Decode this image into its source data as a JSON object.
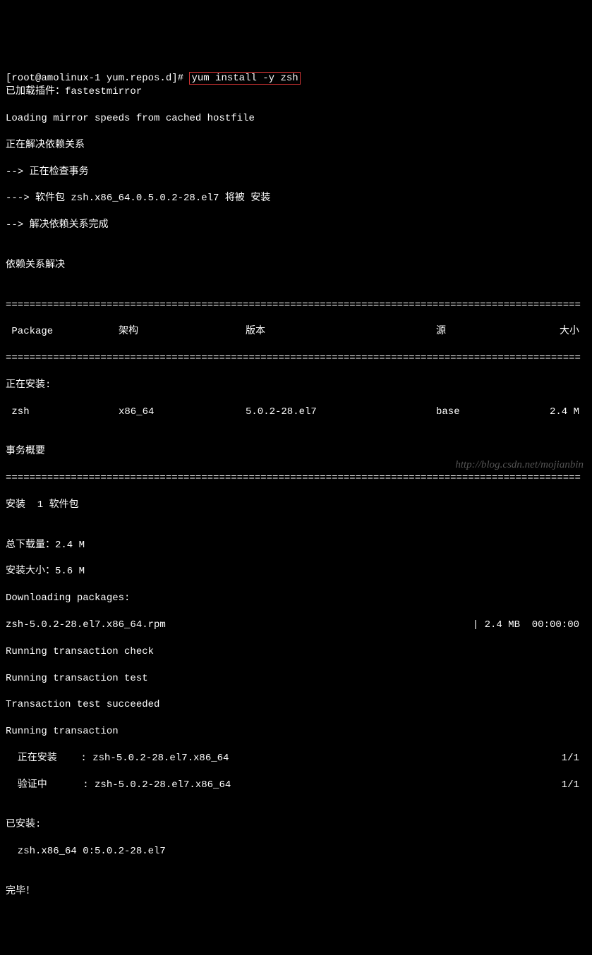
{
  "prompt": {
    "prefix": "[root@amolinux-1 yum.repos.d]# ",
    "command": "yum install -y zsh"
  },
  "lines": {
    "l1": "已加载插件：fastestmirror",
    "l2": "Loading mirror speeds from cached hostfile",
    "l3": "正在解决依赖关系",
    "l4": "--> 正在检查事务",
    "l5": "---> 软件包 zsh.x86_64.0.5.0.2-28.el7 将被 安装",
    "l6": "--> 解决依赖关系完成",
    "l7": "",
    "l8": "依赖关系解决",
    "l9": ""
  },
  "separator": "=================================================================================================",
  "table": {
    "header": {
      "pkg": " Package",
      "arch": "架构",
      "ver": "版本",
      "repo": "源",
      "size": "大小"
    },
    "installing_label": "正在安装:",
    "row1": {
      "pkg": " zsh",
      "arch": "x86_64",
      "ver": "5.0.2-28.el7",
      "repo": "base",
      "size": "2.4 M"
    }
  },
  "summary": {
    "l1": "",
    "l2": "事务概要",
    "l3": "",
    "l4": "安装  1 软件包",
    "l5": "",
    "l6": "总下载量：2.4 M",
    "l7": "安装大小：5.6 M",
    "l8": "Downloading packages:"
  },
  "download": {
    "file": "zsh-5.0.2-28.el7.x86_64.rpm",
    "progress": "| 2.4 MB  00:00:00"
  },
  "transaction": {
    "l1": "Running transaction check",
    "l2": "Running transaction test",
    "l3": "Transaction test succeeded",
    "l4": "Running transaction",
    "install": {
      "left": "  正在安装    : zsh-5.0.2-28.el7.x86_64",
      "right": "1/1"
    },
    "verify": {
      "left": "  验证中      : zsh-5.0.2-28.el7.x86_64",
      "right": "1/1"
    }
  },
  "footer": {
    "l1": "",
    "l2": "已安装:",
    "l3": "  zsh.x86_64 0:5.0.2-28.el7",
    "l4": "",
    "l5": "完毕！"
  },
  "watermark": "http://blog.csdn.net/mojianbin"
}
